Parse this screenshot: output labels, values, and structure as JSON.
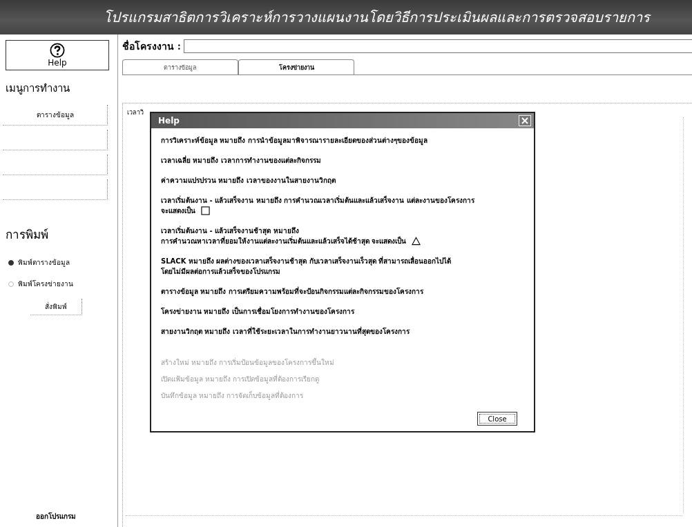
{
  "window": {
    "title": "โปรแกรมสาธิตการวิเคราะห์การวางแผนงานโดยวิธีการประเมินผลและการตรวจสอบรายการ"
  },
  "sidebar": {
    "help_button": "Help",
    "menu_heading": "เมนูการทำงาน",
    "menu_buttons": [
      {
        "kind": "labeled",
        "label": "ตารางข้อมูล"
      },
      {
        "kind": "blank"
      },
      {
        "kind": "blank"
      },
      {
        "kind": "blank"
      }
    ],
    "print_heading": "การพิมพ์",
    "print_options": [
      {
        "label": "พิมพ์ตารางข้อมูล",
        "selected": true
      },
      {
        "label": "พิมพ์โครงข่ายงาน",
        "selected": false
      }
    ],
    "print_button": "สั่งพิมพ์",
    "exit_button": "ออกโปรแกรม"
  },
  "project": {
    "label": "ชื่อโครงงาน :"
  },
  "tabs": [
    {
      "label": "ตารางข้อมูล",
      "selected": false
    },
    {
      "label": "โครงข่ายงาน",
      "selected": true
    }
  ],
  "panel": {
    "partial_label": "เวลาวิ"
  },
  "dialog": {
    "title": "Help",
    "close_button": "Close",
    "entries": [
      {
        "kind": "text",
        "lines": [
          "การวิเคราะห์ข้อมูล หมายถึง การนำข้อมูลมาพิจารณารายละเอียดของส่วนต่างๆของข้อมูล"
        ]
      },
      {
        "kind": "text",
        "lines": [
          "เวลาเฉลี่ย หมายถึง เวลาการทำงานของแต่ละกิจกรรม"
        ]
      },
      {
        "kind": "text",
        "lines": [
          "ค่าความแปรปรวน หมายถึง เวลาของงานในสายงานวิกฤต"
        ]
      },
      {
        "kind": "square",
        "lines": [
          "เวลาเริ่มต้นงาน - แล้วเสร็จงาน หมายถึง การคำนวณเวลาเริ่มต้นและแล้วเสร็จงาน แต่ละงานของโครงการ",
          "จะแสดงเป็น"
        ]
      },
      {
        "kind": "triangle",
        "lines": [
          "เวลาเริ่มต้นงาน - แล้วเสร็จงานช้าสุด หมายถึง",
          "การคำนวณหาเวลาที่ยอมให้งานแต่ละงานเริ่มต้นและแล้วเสร็จได้ช้าสุด จะแสดงเป็น"
        ]
      },
      {
        "kind": "text",
        "lines": [
          "SLACK หมายถึง ผลต่างของเวลาเสร็จงานช้าสุด กับเวลาเสร็จงานเร็วสุด ที่สามารถเลื่อนออกไปได้",
          "โดยไม่มีผลต่อการแล้วเสร็จของโปรแกรม"
        ]
      },
      {
        "kind": "text",
        "lines": [
          "ตารางข้อมูล หมายถึง การเตรียมความพร้อมที่จะป้อนกิจกรรมแต่ละกิจกรรมของโครงการ"
        ]
      },
      {
        "kind": "text",
        "lines": [
          "โครงข่ายงาน หมายถึง เป็นการเชื่อมโยงการทำงานของโครงการ"
        ]
      },
      {
        "kind": "text",
        "lines": [
          "สายงานวิกฤต หมายถึง เวลาที่ใช้ระยะเวลาในการทำงานยาวนานที่สุดของโครงการ"
        ]
      }
    ],
    "notes": [
      "สร้างใหม่ หมายถึง การเริ่มป้อนข้อมูลของโครงการขึ้นใหม่",
      "เปิดแฟ้มข้อมูล หมายถึง การเปิดข้อมูลที่ต้องการเรียกดู",
      "บันทึกข้อมูล หมายถึง การจัดเก็บข้อมูลที่ต้องการ"
    ]
  }
}
